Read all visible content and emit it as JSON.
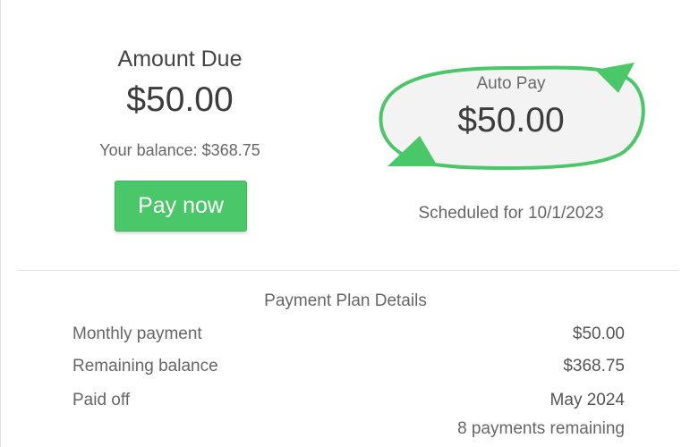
{
  "amount_due": {
    "title": "Amount Due",
    "value": "$50.00",
    "balance_text": "Your balance: $368.75",
    "pay_button_label": "Pay now"
  },
  "auto_pay": {
    "label": "Auto Pay",
    "value": "$50.00",
    "scheduled_text": "Scheduled for 10/1/2023",
    "icon": "autopay-cycle-arrows-icon"
  },
  "payment_plan": {
    "title": "Payment Plan Details",
    "rows": [
      {
        "label": "Monthly payment",
        "value": "$50.00"
      },
      {
        "label": "Remaining balance",
        "value": "$368.75"
      },
      {
        "label": "Paid off",
        "value": "May 2024"
      }
    ],
    "payments_remaining": "8 payments remaining"
  },
  "colors": {
    "accent_green": "#4ac768",
    "text": "#4a4a4a",
    "divider": "#e4e4e4"
  }
}
